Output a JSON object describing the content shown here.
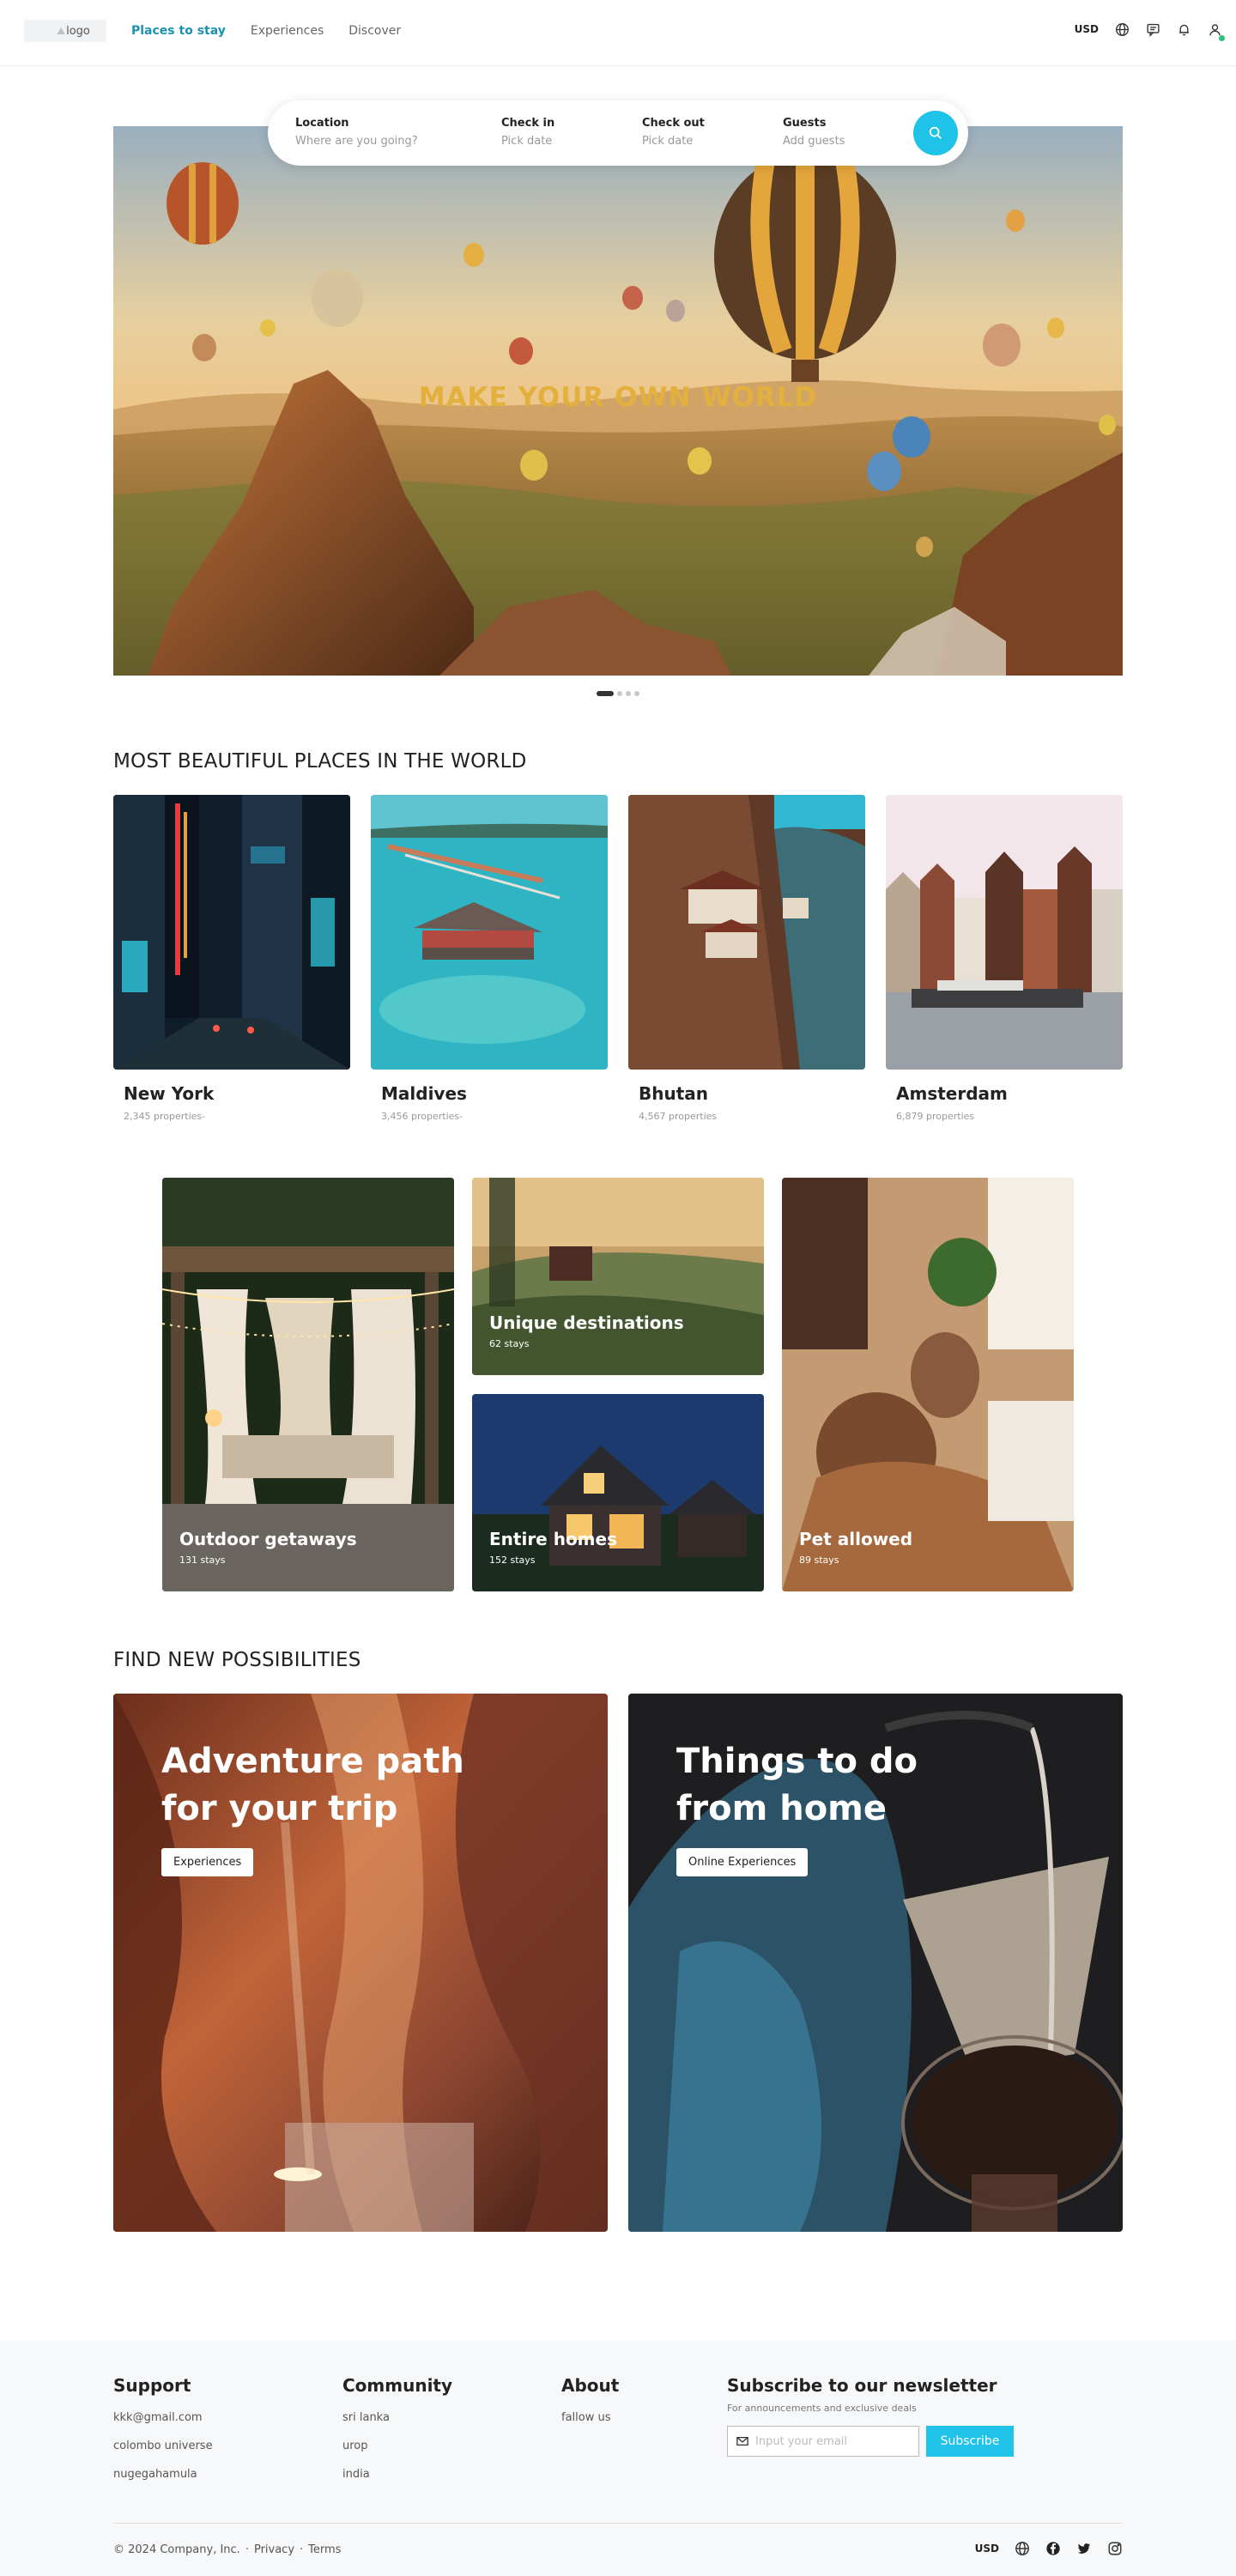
{
  "header": {
    "logo_text": "logo",
    "nav": [
      {
        "label": "Places to stay",
        "active": true
      },
      {
        "label": "Experiences",
        "active": false
      },
      {
        "label": "Discover",
        "active": false
      }
    ],
    "currency": "USD",
    "icons": [
      "globe-icon",
      "chat-icon",
      "bell-icon",
      "user-icon"
    ]
  },
  "search": {
    "fields": [
      {
        "label": "Location",
        "value": "Where are you going?"
      },
      {
        "label": "Check in",
        "value": "Pick date"
      },
      {
        "label": "Check out",
        "value": "Pick date"
      },
      {
        "label": "Guests",
        "value": "Add guests"
      }
    ],
    "button_icon": "search-icon"
  },
  "hero": {
    "title": "MAKE YOUR OWN WORLD",
    "slides_total": 4,
    "slide_active": 1
  },
  "places": {
    "title": "MOST BEAUTIFUL PLACES IN THE WORLD",
    "items": [
      {
        "name": "New York",
        "count": "2,345 properties-"
      },
      {
        "name": "Maldives",
        "count": "3,456 properties-"
      },
      {
        "name": "Bhutan",
        "count": "4,567 properties"
      },
      {
        "name": "Amsterdam",
        "count": "6,879 properties"
      }
    ]
  },
  "categories": [
    {
      "title": "Outdoor getaways",
      "count": "131 stays"
    },
    {
      "title": "Unique destinations",
      "count": "62 stays"
    },
    {
      "title": "Entire homes",
      "count": "152 stays"
    },
    {
      "title": "Pet allowed",
      "count": "89 stays"
    }
  ],
  "possibilities": {
    "title": "FIND NEW POSSIBILITIES",
    "cards": [
      {
        "title": "Adventure path for your trip",
        "button": "Experiences"
      },
      {
        "title": "Things to do from home",
        "button": "Online Experiences"
      }
    ]
  },
  "footer": {
    "support": {
      "title": "Support",
      "links": [
        "kkk@gmail.com",
        "colombo universe",
        "nugegahamula"
      ]
    },
    "community": {
      "title": "Community",
      "links": [
        "sri lanka",
        "urop",
        "india"
      ]
    },
    "about": {
      "title": "About",
      "links": [
        "fallow us"
      ]
    },
    "newsletter": {
      "title": "Subscribe to our newsletter",
      "subtitle": "For announcements and exclusive deals",
      "placeholder": "Input your email",
      "button": "Subscribe"
    },
    "copyright": "© 2024 Company, Inc.",
    "legal": [
      "Privacy",
      "Terms"
    ],
    "currency": "USD",
    "social_icons": [
      "globe-icon",
      "facebook-icon",
      "twitter-icon",
      "instagram-icon"
    ]
  },
  "colors": {
    "accent": "#20c3e8",
    "nav_active": "#1b93b0",
    "hero_title": "#e3b03d"
  }
}
